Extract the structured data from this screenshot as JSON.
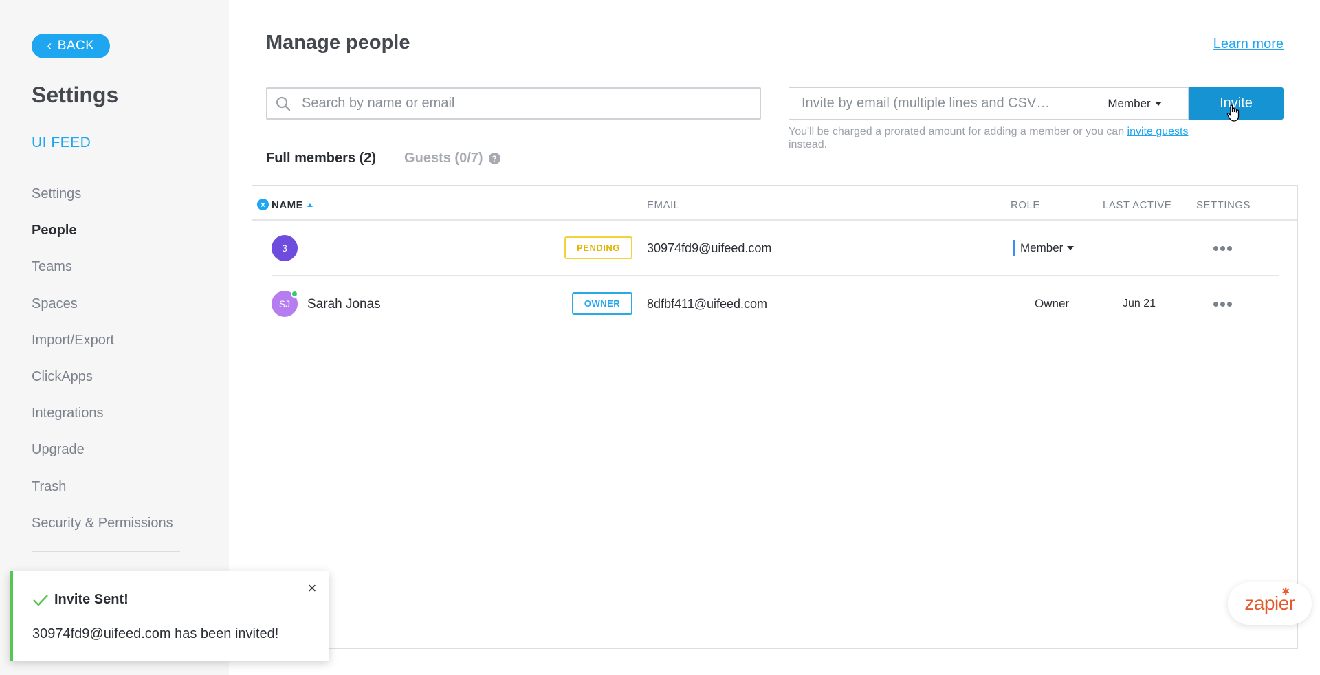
{
  "sidebar": {
    "back_label": "BACK",
    "title": "Settings",
    "workspace": "UI FEED",
    "items": [
      {
        "label": "Settings"
      },
      {
        "label": "People"
      },
      {
        "label": "Teams"
      },
      {
        "label": "Spaces"
      },
      {
        "label": "Import/Export"
      },
      {
        "label": "ClickApps"
      },
      {
        "label": "Integrations"
      },
      {
        "label": "Upgrade"
      },
      {
        "label": "Trash"
      },
      {
        "label": "Security & Permissions"
      }
    ],
    "active_item": "People"
  },
  "header": {
    "title": "Manage people",
    "learn_more": "Learn more"
  },
  "search": {
    "placeholder": "Search by name or email",
    "value": ""
  },
  "invite": {
    "placeholder": "Invite by email (multiple lines and CSV…",
    "value": "",
    "role": "Member",
    "button": "Invite",
    "note_prefix": "You'll be charged a prorated amount for adding a member or you can ",
    "note_link": "invite guests",
    "note_suffix": "instead."
  },
  "tabs": [
    {
      "label": "Full members (2)",
      "active": true
    },
    {
      "label": "Guests (0/7)",
      "active": false
    }
  ],
  "table": {
    "columns": {
      "name": "NAME",
      "email": "EMAIL",
      "role": "ROLE",
      "last_active": "LAST ACTIVE",
      "settings": "SETTINGS"
    },
    "rows": [
      {
        "avatar": "3",
        "name": "",
        "badge": "PENDING",
        "email": "30974fd9@uifeed.com",
        "role": "Member",
        "last_active": ""
      },
      {
        "avatar": "SJ",
        "name": "Sarah Jonas",
        "badge": "OWNER",
        "email": "8dfbf411@uifeed.com",
        "role": "Owner",
        "last_active": "Jun 21"
      }
    ]
  },
  "toast": {
    "title": "Invite Sent!",
    "message": "30974fd9@uifeed.com has been invited!"
  },
  "zapier": {
    "label": "zapier"
  },
  "colors": {
    "accent": "#1fa6f0",
    "invite_button": "#1593d2",
    "success": "#58c453",
    "pending": "#f3d23b"
  },
  "icons": [
    "chevron-left-icon",
    "search-icon",
    "caret-down-icon",
    "help-icon",
    "clear-sort-icon",
    "sort-up-icon",
    "more-icon",
    "check-icon",
    "close-icon",
    "cursor-hand-icon"
  ]
}
